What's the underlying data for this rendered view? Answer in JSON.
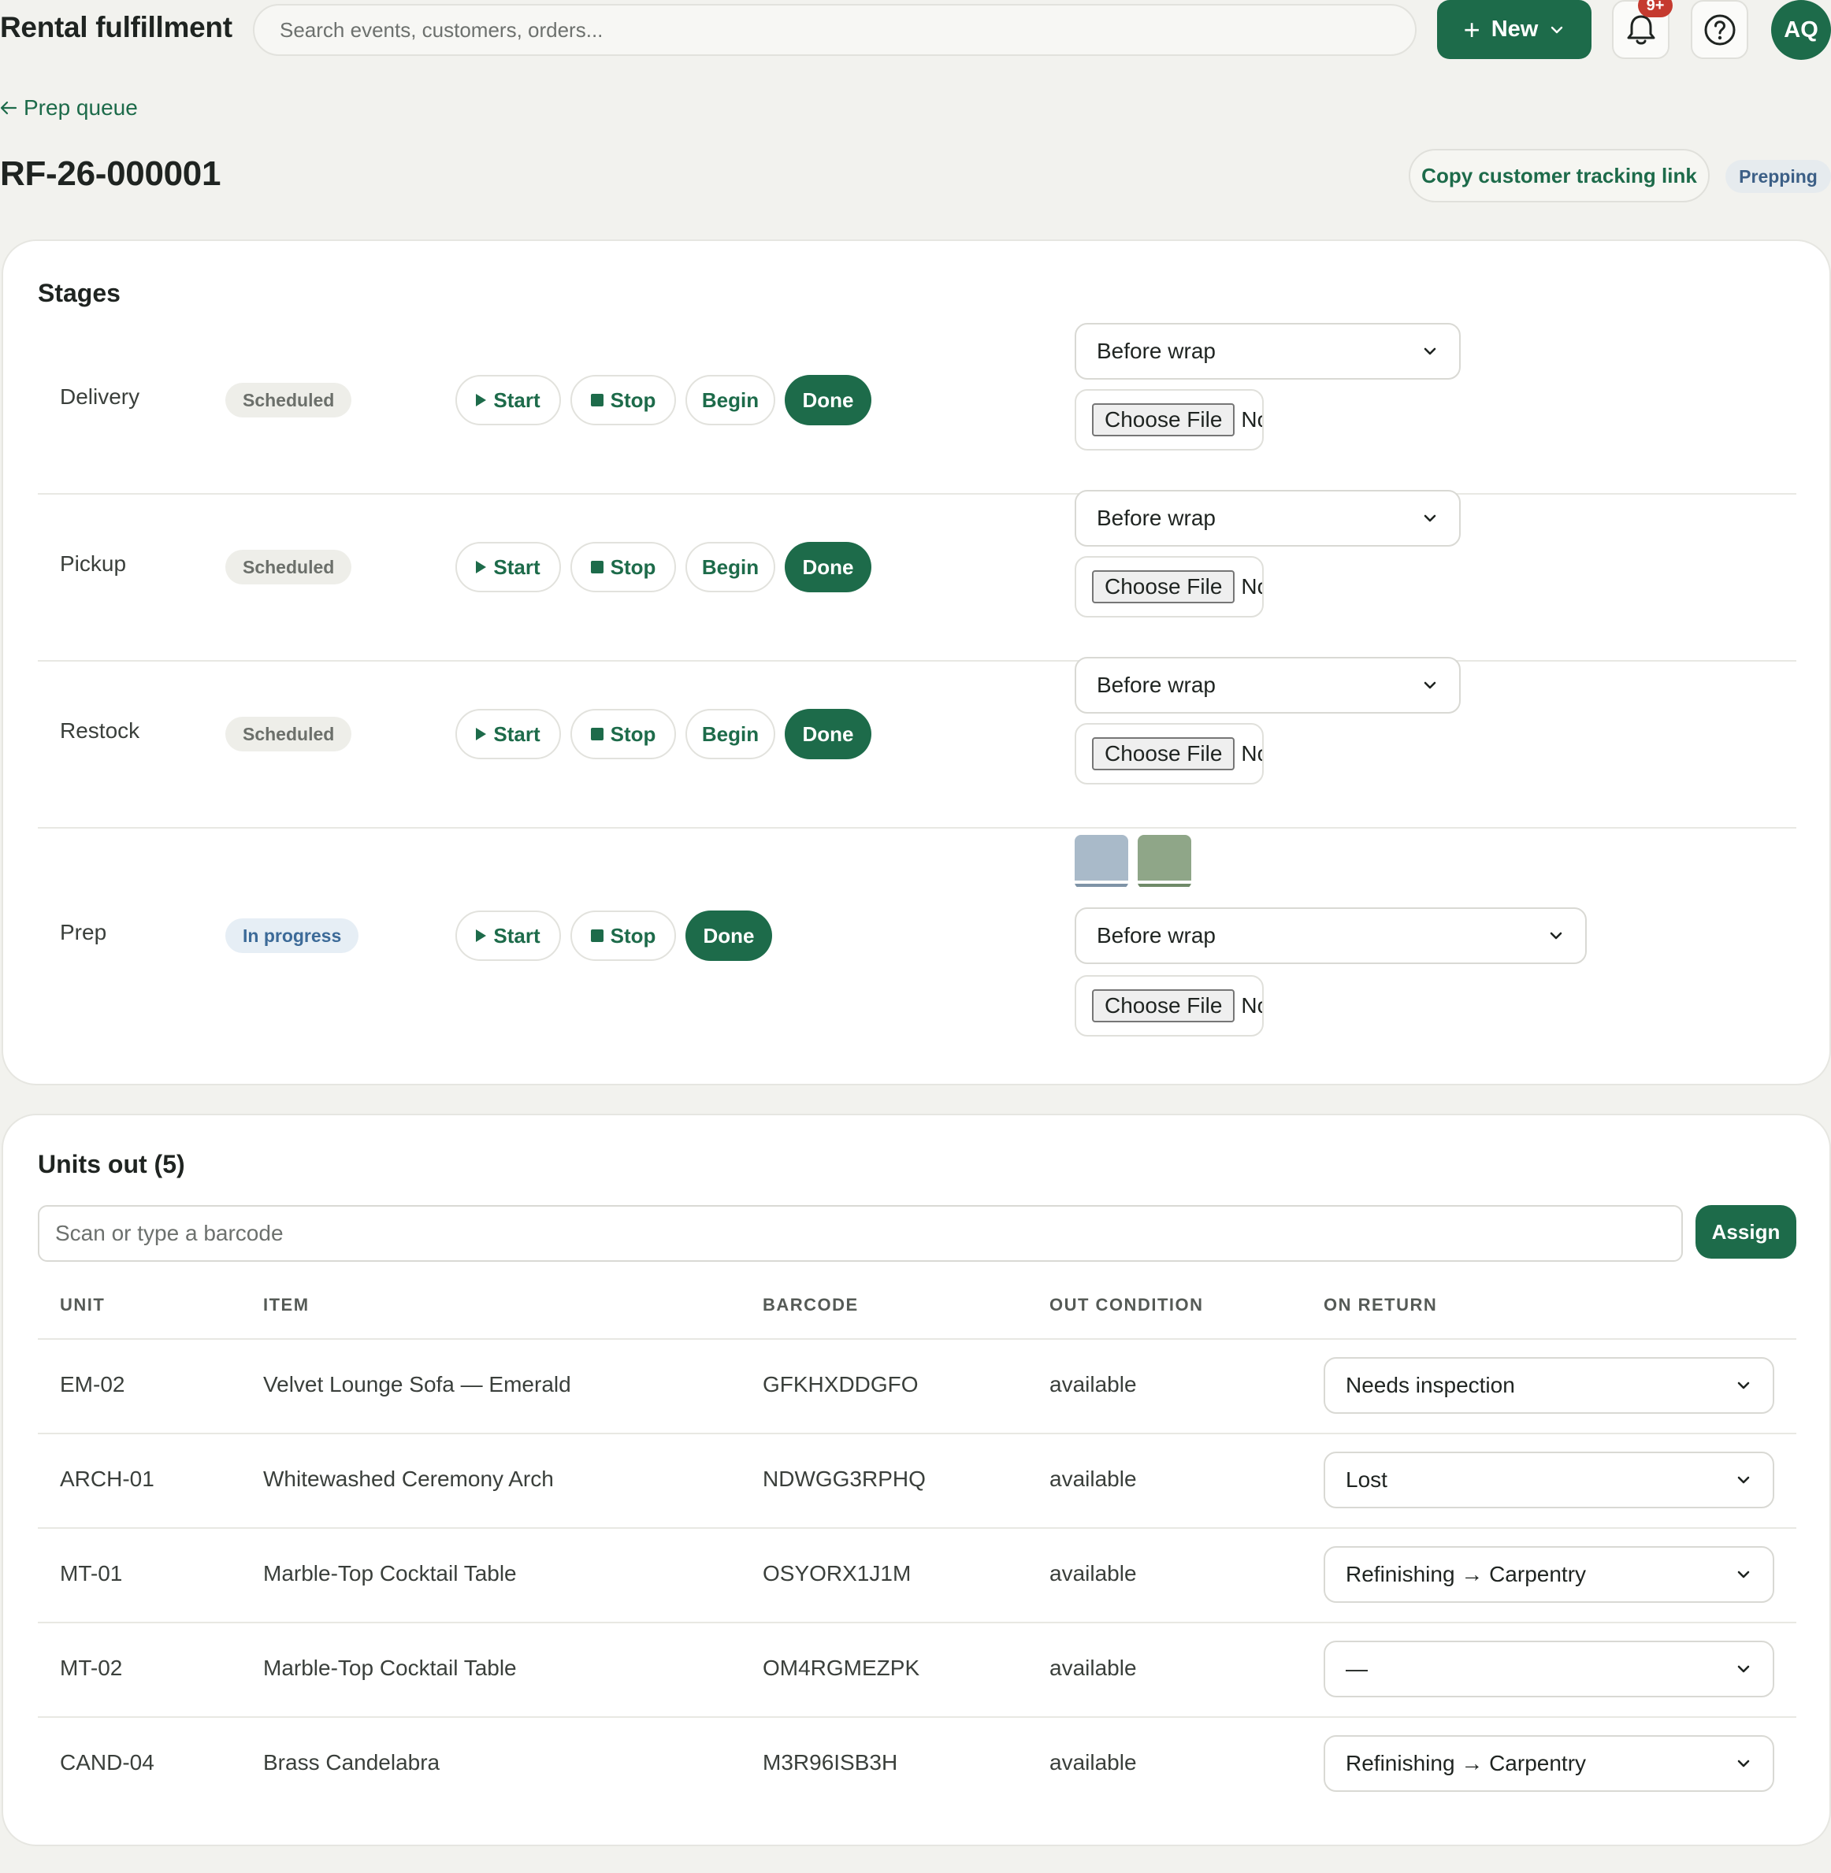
{
  "header": {
    "app_title": "Rental fulfillment",
    "search_placeholder": "Search events, customers, orders...",
    "new_label": "New",
    "notification_count": "9+",
    "avatar_initials": "AQ"
  },
  "breadcrumb": {
    "back_label": "Prep queue"
  },
  "order": {
    "id": "RF-26-000001",
    "copy_tracking_label": "Copy customer tracking link",
    "status": "Prepping"
  },
  "stages": {
    "title": "Stages",
    "rows": [
      {
        "name": "Delivery",
        "status": "Scheduled",
        "start_label": "Start",
        "stop_label": "Stop",
        "begin_label": "Begin",
        "done_label": "Done",
        "photo_type": "Before wrap",
        "file_button": "Choose File",
        "file_status": "No file chosen"
      },
      {
        "name": "Pickup",
        "status": "Scheduled",
        "start_label": "Start",
        "stop_label": "Stop",
        "begin_label": "Begin",
        "done_label": "Done",
        "photo_type": "Before wrap",
        "file_button": "Choose File",
        "file_status": "No file chosen"
      },
      {
        "name": "Restock",
        "status": "Scheduled",
        "start_label": "Start",
        "stop_label": "Stop",
        "begin_label": "Begin",
        "done_label": "Done",
        "photo_type": "Before wrap",
        "file_button": "Choose File",
        "file_status": "No file chosen"
      },
      {
        "name": "Prep",
        "status": "In progress",
        "start_label": "Start",
        "stop_label": "Stop",
        "done_label": "Done",
        "photo_type": "Before wrap",
        "file_button": "Choose File",
        "file_status": "No file chosen"
      }
    ]
  },
  "units": {
    "title": "Units out (5)",
    "scan_placeholder": "Scan or type a barcode",
    "assign_label": "Assign",
    "columns": [
      "UNIT",
      "ITEM",
      "BARCODE",
      "OUT CONDITION",
      "ON RETURN"
    ],
    "rows": [
      {
        "unit": "EM-02",
        "item": "Velvet Lounge Sofa — Emerald",
        "barcode": "GFKHXDDGFO",
        "out_condition": "available",
        "on_return": "Needs inspection"
      },
      {
        "unit": "ARCH-01",
        "item": "Whitewashed Ceremony Arch",
        "barcode": "NDWGG3RPHQ",
        "out_condition": "available",
        "on_return": "Lost"
      },
      {
        "unit": "MT-01",
        "item": "Marble-Top Cocktail Table",
        "barcode": "OSYORX1J1M",
        "out_condition": "available",
        "on_return": "Refinishing → Carpentry"
      },
      {
        "unit": "MT-02",
        "item": "Marble-Top Cocktail Table",
        "barcode": "OM4RGMEZPK",
        "out_condition": "available",
        "on_return": "—"
      },
      {
        "unit": "CAND-04",
        "item": "Brass Candelabra",
        "barcode": "M3R96ISB3H",
        "out_condition": "available",
        "on_return": "Refinishing → Carpentry"
      }
    ]
  },
  "colors": {
    "brand": "#1d6b4a",
    "notification": "#c53a2f",
    "background": "#f2f2ee",
    "status_prepping": "#3c5f86",
    "photo_thumb_1": "#a9bac9",
    "photo_thumb_2": "#8fa688"
  }
}
